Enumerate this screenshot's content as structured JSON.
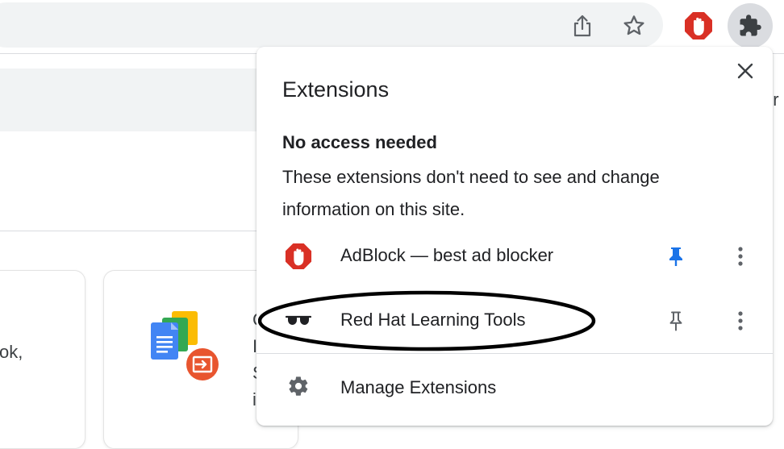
{
  "toolbar": {
    "share_icon": "share-icon",
    "bookmark_icon": "star-icon",
    "adblock_icon": "adblock-hand-icon",
    "extensions_icon": "puzzle-piece-icon"
  },
  "page": {
    "card_left_text": "ok,",
    "card_mid_letters": [
      "C",
      "I",
      "S",
      "i"
    ],
    "right_fragment": "er"
  },
  "popup": {
    "title": "Extensions",
    "close_icon": "close-icon",
    "section_heading": "No access needed",
    "section_description": "These extensions don't need to see and change information on this site.",
    "extensions": [
      {
        "name": "AdBlock — best ad blocker",
        "icon": "adblock-hand-icon",
        "pinned": true
      },
      {
        "name": "Red Hat Learning Tools",
        "icon": "sunglasses-icon",
        "pinned": false
      }
    ],
    "manage_label": "Manage Extensions",
    "manage_icon": "gear-icon"
  },
  "colors": {
    "adblock_red": "#d93025",
    "pin_active_blue": "#1a73e8",
    "icon_gray": "#5f6368"
  }
}
